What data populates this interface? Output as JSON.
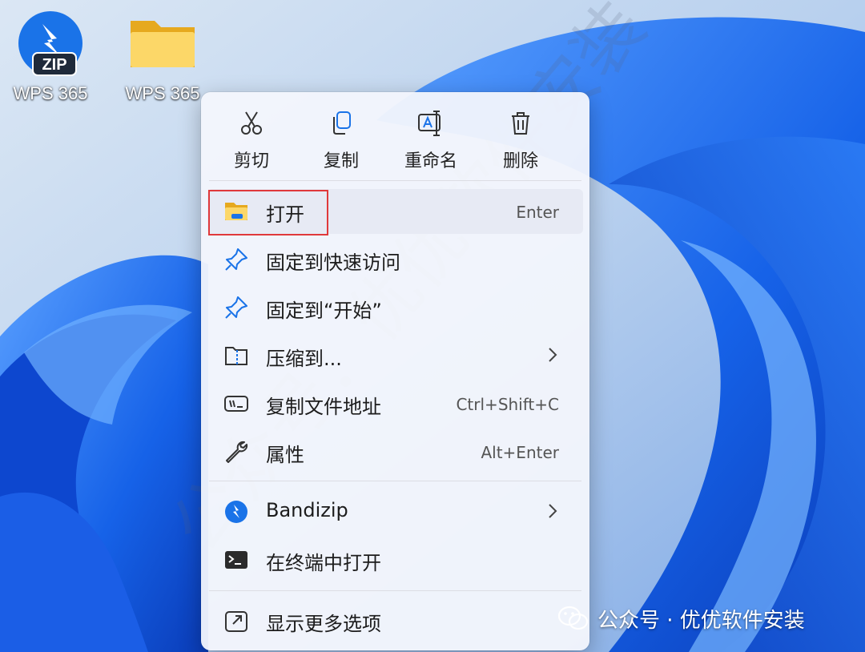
{
  "desktop": {
    "icons": [
      {
        "label": "WPS 365",
        "badge": "ZIP",
        "icon": "wps-zip-icon"
      },
      {
        "label": "WPS 365",
        "icon": "folder-icon"
      }
    ]
  },
  "menu": {
    "quick_actions": [
      {
        "label": "剪切",
        "icon": "cut-icon"
      },
      {
        "label": "复制",
        "icon": "copy-icon"
      },
      {
        "label": "重命名",
        "icon": "rename-icon"
      },
      {
        "label": "删除",
        "icon": "delete-icon"
      }
    ],
    "items": [
      {
        "label": "打开",
        "shortcut": "Enter",
        "icon": "folder-open-icon"
      },
      {
        "label": "固定到快速访问",
        "icon": "pin-icon"
      },
      {
        "label": "固定到“开始”",
        "icon": "pin-icon"
      },
      {
        "label": "压缩到...",
        "icon": "zip-archive-icon",
        "submenu": true
      },
      {
        "label": "复制文件地址",
        "shortcut": "Ctrl+Shift+C",
        "icon": "copy-path-icon"
      },
      {
        "label": "属性",
        "shortcut": "Alt+Enter",
        "icon": "wrench-icon"
      },
      {
        "label": "Bandizip",
        "icon": "bandizip-icon",
        "submenu": true
      },
      {
        "label": "在终端中打开",
        "icon": "terminal-icon"
      },
      {
        "label": "显示更多选项",
        "icon": "more-options-icon"
      }
    ]
  },
  "watermark": "公众号：优优软件安装",
  "brand": {
    "label": "公众号 · 优优软件安装",
    "icon": "wechat-icon"
  },
  "colors": {
    "accent": "#1a73e8",
    "highlight_box": "#e0393b",
    "folder": "#f5c542"
  }
}
